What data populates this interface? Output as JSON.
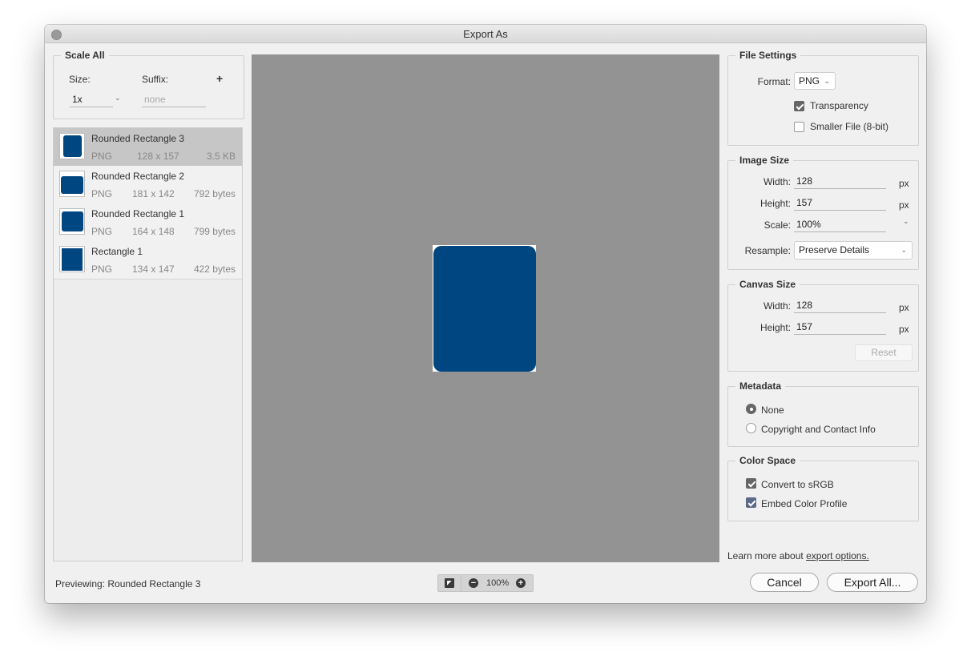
{
  "window": {
    "title": "Export As"
  },
  "scale_all": {
    "title": "Scale All",
    "size_label": "Size:",
    "suffix_label": "Suffix:",
    "add_symbol": "+",
    "size_value": "1x",
    "suffix_placeholder": "none"
  },
  "assets": [
    {
      "name": "Rounded Rectangle 3",
      "format": "PNG",
      "dims": "128 x 157",
      "size": "3.5 KB",
      "selected": true
    },
    {
      "name": "Rounded Rectangle 2",
      "format": "PNG",
      "dims": "181 x 142",
      "size": "792 bytes",
      "selected": false
    },
    {
      "name": "Rounded Rectangle 1",
      "format": "PNG",
      "dims": "164 x 148",
      "size": "799 bytes",
      "selected": false
    },
    {
      "name": "Rectangle 1",
      "format": "PNG",
      "dims": "134 x 147",
      "size": "422 bytes",
      "selected": false
    }
  ],
  "file_settings": {
    "title": "File Settings",
    "format_label": "Format:",
    "format_value": "PNG",
    "transparency_label": "Transparency",
    "transparency_checked": true,
    "smaller_file_label": "Smaller File (8-bit)",
    "smaller_file_checked": false
  },
  "image_size": {
    "title": "Image Size",
    "width_label": "Width:",
    "width_value": "128",
    "height_label": "Height:",
    "height_value": "157",
    "scale_label": "Scale:",
    "scale_value": "100%",
    "resample_label": "Resample:",
    "resample_value": "Preserve Details",
    "unit": "px"
  },
  "canvas_size": {
    "title": "Canvas Size",
    "width_label": "Width:",
    "width_value": "128",
    "height_label": "Height:",
    "height_value": "157",
    "unit": "px",
    "reset_label": "Reset"
  },
  "metadata": {
    "title": "Metadata",
    "none_label": "None",
    "copyright_label": "Copyright and Contact Info",
    "selected": "None"
  },
  "color_space": {
    "title": "Color Space",
    "convert_label": "Convert to sRGB",
    "convert_checked": true,
    "embed_label": "Embed Color Profile",
    "embed_checked": true
  },
  "footer": {
    "learn_more": "Learn more about",
    "learn_link": "export options.",
    "previewing": "Previewing:  Rounded Rectangle 3",
    "zoom_level": "100%",
    "zoom_minus": "−",
    "zoom_plus": "+",
    "cancel_label": "Cancel",
    "export_label": "Export All..."
  },
  "colors": {
    "artwork": "#004680",
    "preview_bg": "#939393",
    "window_bg": "#f0f0f0"
  },
  "icons": {
    "close": "close-dot",
    "chevron": "chevron-down-icon",
    "check": "checkmark-icon",
    "zoom_toggle": "canvas-toggle-icon"
  }
}
